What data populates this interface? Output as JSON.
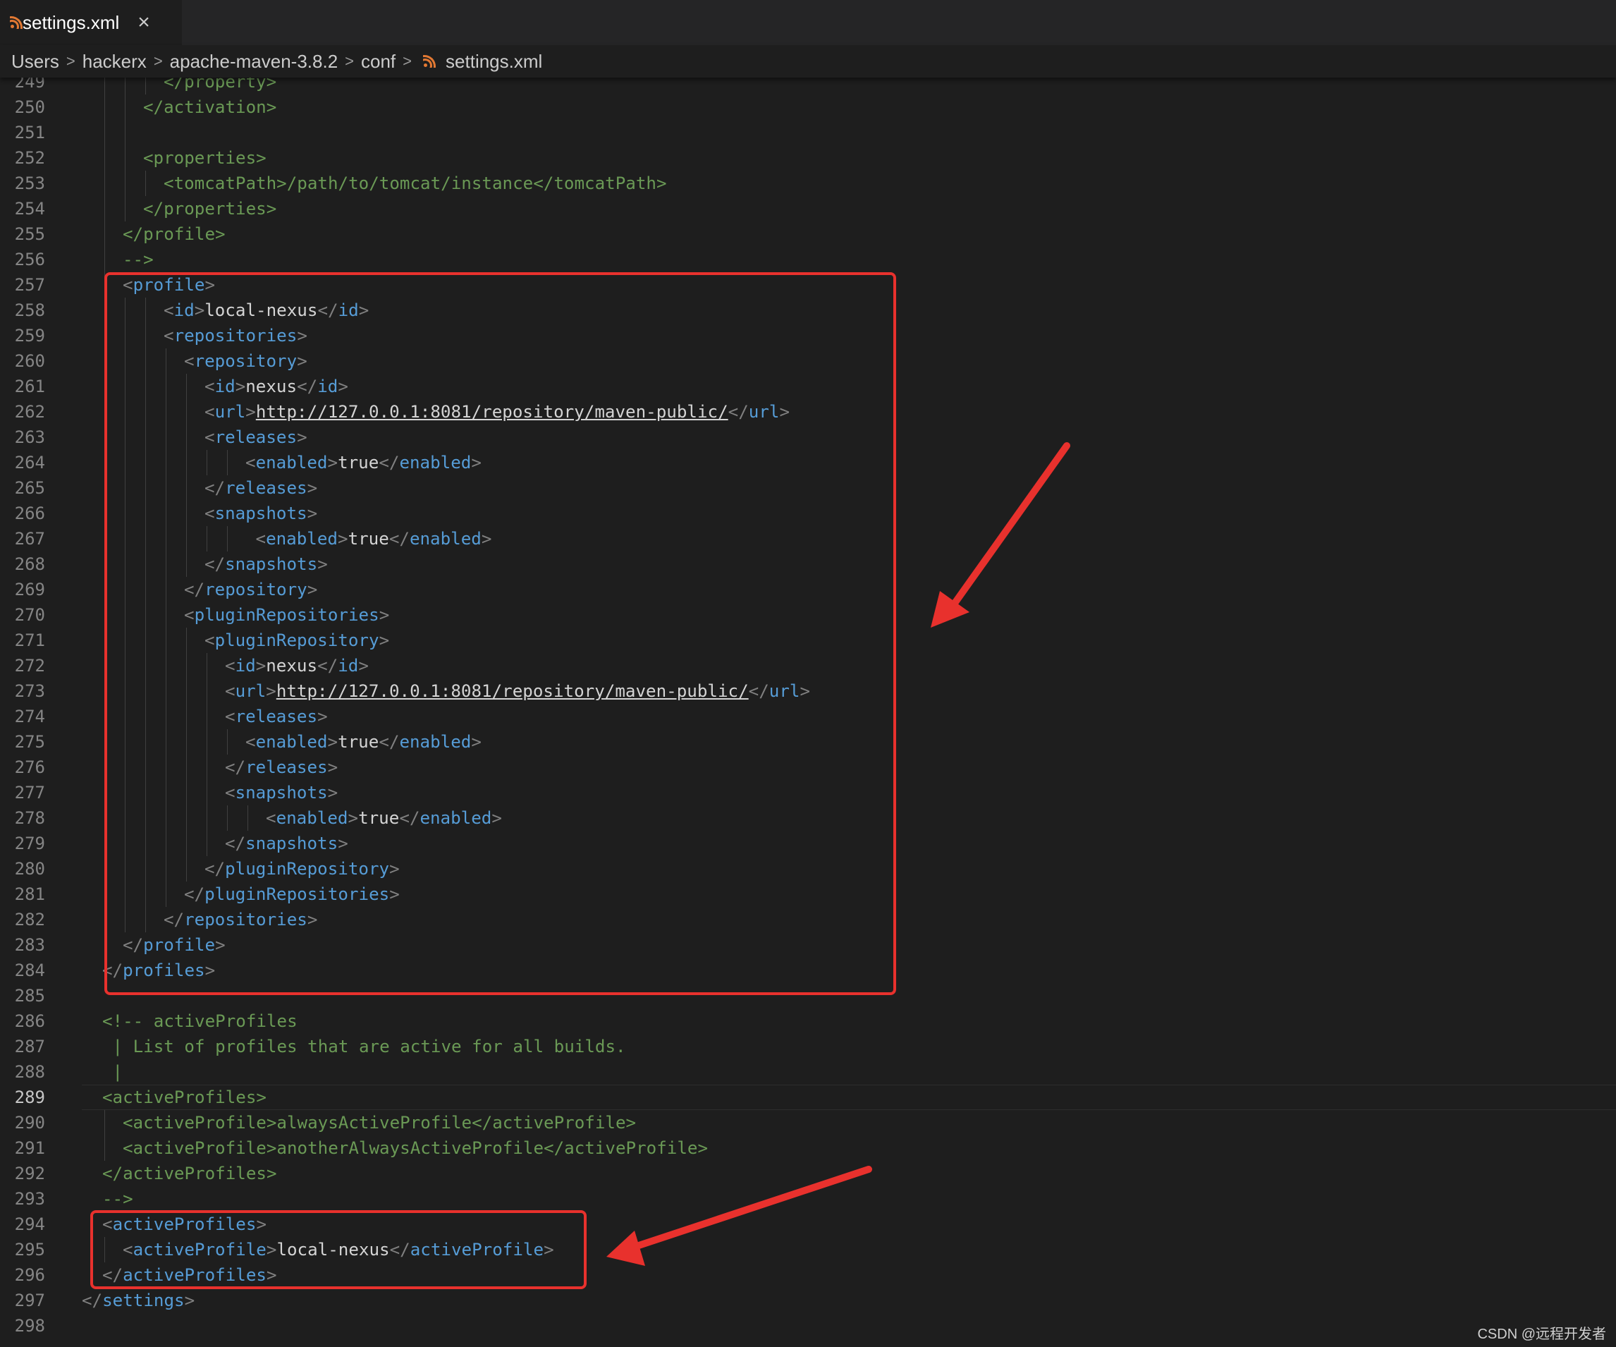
{
  "tab": {
    "filename": "settings.xml",
    "close_glyph": "×",
    "icon": "rss-icon"
  },
  "breadcrumb": {
    "segments": [
      "Users",
      "hackerx",
      "apache-maven-3.8.2",
      "conf"
    ],
    "file": "settings.xml",
    "separator": ">"
  },
  "editor": {
    "active_line": 289,
    "lines": [
      {
        "n": "249",
        "indent": 3,
        "tokens": [
          [
            "c",
            "</property>"
          ]
        ]
      },
      {
        "n": "250",
        "indent": 2,
        "tokens": [
          [
            "c",
            "</activation>"
          ]
        ]
      },
      {
        "n": "251",
        "indent": 2,
        "tokens": []
      },
      {
        "n": "252",
        "indent": 2,
        "tokens": [
          [
            "c",
            "<properties>"
          ]
        ]
      },
      {
        "n": "253",
        "indent": 3,
        "tokens": [
          [
            "c",
            "<tomcatPath>/path/to/tomcat/instance</tomcatPath>"
          ]
        ]
      },
      {
        "n": "254",
        "indent": 2,
        "tokens": [
          [
            "c",
            "</properties>"
          ]
        ]
      },
      {
        "n": "255",
        "indent": 1,
        "tokens": [
          [
            "c",
            "</profile>"
          ]
        ]
      },
      {
        "n": "256",
        "indent": 1,
        "tokens": [
          [
            "c",
            "-->"
          ]
        ]
      },
      {
        "n": "257",
        "indent": 1,
        "tokens": [
          [
            "g",
            "<"
          ],
          [
            "t",
            "profile"
          ],
          [
            "g",
            ">"
          ]
        ]
      },
      {
        "n": "258",
        "indent": 3,
        "tokens": [
          [
            "g",
            "<"
          ],
          [
            "t",
            "id"
          ],
          [
            "g",
            ">"
          ],
          [
            "x",
            "local-nexus"
          ],
          [
            "g",
            "</"
          ],
          [
            "t",
            "id"
          ],
          [
            "g",
            ">"
          ]
        ]
      },
      {
        "n": "259",
        "indent": 3,
        "tokens": [
          [
            "g",
            "<"
          ],
          [
            "t",
            "repositories"
          ],
          [
            "g",
            ">"
          ]
        ]
      },
      {
        "n": "260",
        "indent": 4,
        "tokens": [
          [
            "g",
            "<"
          ],
          [
            "t",
            "repository"
          ],
          [
            "g",
            ">"
          ]
        ]
      },
      {
        "n": "261",
        "indent": 5,
        "tokens": [
          [
            "g",
            "<"
          ],
          [
            "t",
            "id"
          ],
          [
            "g",
            ">"
          ],
          [
            "x",
            "nexus"
          ],
          [
            "g",
            "</"
          ],
          [
            "t",
            "id"
          ],
          [
            "g",
            ">"
          ]
        ]
      },
      {
        "n": "262",
        "indent": 5,
        "tokens": [
          [
            "g",
            "<"
          ],
          [
            "t",
            "url"
          ],
          [
            "g",
            ">"
          ],
          [
            "u",
            "http://127.0.0.1:8081/repository/maven-public/"
          ],
          [
            "g",
            "</"
          ],
          [
            "t",
            "url"
          ],
          [
            "g",
            ">"
          ]
        ]
      },
      {
        "n": "263",
        "indent": 5,
        "tokens": [
          [
            "g",
            "<"
          ],
          [
            "t",
            "releases"
          ],
          [
            "g",
            ">"
          ]
        ]
      },
      {
        "n": "264",
        "indent": 7,
        "tokens": [
          [
            "g",
            "<"
          ],
          [
            "t",
            "enabled"
          ],
          [
            "g",
            ">"
          ],
          [
            "x",
            "true"
          ],
          [
            "g",
            "</"
          ],
          [
            "t",
            "enabled"
          ],
          [
            "g",
            ">"
          ]
        ]
      },
      {
        "n": "265",
        "indent": 5,
        "tokens": [
          [
            "g",
            "</"
          ],
          [
            "t",
            "releases"
          ],
          [
            "g",
            ">"
          ]
        ]
      },
      {
        "n": "266",
        "indent": 5,
        "tokens": [
          [
            "g",
            "<"
          ],
          [
            "t",
            "snapshots"
          ],
          [
            "g",
            ">"
          ]
        ]
      },
      {
        "n": "267",
        "indent": 7.5,
        "tokens": [
          [
            "g",
            "<"
          ],
          [
            "t",
            "enabled"
          ],
          [
            "g",
            ">"
          ],
          [
            "x",
            "true"
          ],
          [
            "g",
            "</"
          ],
          [
            "t",
            "enabled"
          ],
          [
            "g",
            ">"
          ]
        ]
      },
      {
        "n": "268",
        "indent": 5,
        "tokens": [
          [
            "g",
            "</"
          ],
          [
            "t",
            "snapshots"
          ],
          [
            "g",
            ">"
          ]
        ]
      },
      {
        "n": "269",
        "indent": 4,
        "tokens": [
          [
            "g",
            "</"
          ],
          [
            "t",
            "repository"
          ],
          [
            "g",
            ">"
          ]
        ]
      },
      {
        "n": "270",
        "indent": 4,
        "tokens": [
          [
            "g",
            "<"
          ],
          [
            "t",
            "pluginRepositories"
          ],
          [
            "g",
            ">"
          ]
        ]
      },
      {
        "n": "271",
        "indent": 5,
        "tokens": [
          [
            "g",
            "<"
          ],
          [
            "t",
            "pluginRepository"
          ],
          [
            "g",
            ">"
          ]
        ]
      },
      {
        "n": "272",
        "indent": 6,
        "tokens": [
          [
            "g",
            "<"
          ],
          [
            "t",
            "id"
          ],
          [
            "g",
            ">"
          ],
          [
            "x",
            "nexus"
          ],
          [
            "g",
            "</"
          ],
          [
            "t",
            "id"
          ],
          [
            "g",
            ">"
          ]
        ]
      },
      {
        "n": "273",
        "indent": 6,
        "tokens": [
          [
            "g",
            "<"
          ],
          [
            "t",
            "url"
          ],
          [
            "g",
            ">"
          ],
          [
            "u",
            "http://127.0.0.1:8081/repository/maven-public/"
          ],
          [
            "g",
            "</"
          ],
          [
            "t",
            "url"
          ],
          [
            "g",
            ">"
          ]
        ]
      },
      {
        "n": "274",
        "indent": 6,
        "tokens": [
          [
            "g",
            "<"
          ],
          [
            "t",
            "releases"
          ],
          [
            "g",
            ">"
          ]
        ]
      },
      {
        "n": "275",
        "indent": 7,
        "tokens": [
          [
            "g",
            "<"
          ],
          [
            "t",
            "enabled"
          ],
          [
            "g",
            ">"
          ],
          [
            "x",
            "true"
          ],
          [
            "g",
            "</"
          ],
          [
            "t",
            "enabled"
          ],
          [
            "g",
            ">"
          ]
        ]
      },
      {
        "n": "276",
        "indent": 6,
        "tokens": [
          [
            "g",
            "</"
          ],
          [
            "t",
            "releases"
          ],
          [
            "g",
            ">"
          ]
        ]
      },
      {
        "n": "277",
        "indent": 6,
        "tokens": [
          [
            "g",
            "<"
          ],
          [
            "t",
            "snapshots"
          ],
          [
            "g",
            ">"
          ]
        ]
      },
      {
        "n": "278",
        "indent": 8,
        "tokens": [
          [
            "g",
            "<"
          ],
          [
            "t",
            "enabled"
          ],
          [
            "g",
            ">"
          ],
          [
            "x",
            "true"
          ],
          [
            "g",
            "</"
          ],
          [
            "t",
            "enabled"
          ],
          [
            "g",
            ">"
          ]
        ]
      },
      {
        "n": "279",
        "indent": 6,
        "tokens": [
          [
            "g",
            "</"
          ],
          [
            "t",
            "snapshots"
          ],
          [
            "g",
            ">"
          ]
        ]
      },
      {
        "n": "280",
        "indent": 5,
        "tokens": [
          [
            "g",
            "</"
          ],
          [
            "t",
            "pluginRepository"
          ],
          [
            "g",
            ">"
          ]
        ]
      },
      {
        "n": "281",
        "indent": 4,
        "tokens": [
          [
            "g",
            "</"
          ],
          [
            "t",
            "pluginRepositories"
          ],
          [
            "g",
            ">"
          ]
        ]
      },
      {
        "n": "282",
        "indent": 3,
        "tokens": [
          [
            "g",
            "</"
          ],
          [
            "t",
            "repositories"
          ],
          [
            "g",
            ">"
          ]
        ]
      },
      {
        "n": "283",
        "indent": 1,
        "tokens": [
          [
            "g",
            "</"
          ],
          [
            "t",
            "profile"
          ],
          [
            "g",
            ">"
          ]
        ]
      },
      {
        "n": "284",
        "indent": 0,
        "tokens": [
          [
            "g",
            "</"
          ],
          [
            "t",
            "profiles"
          ],
          [
            "g",
            ">"
          ]
        ]
      },
      {
        "n": "285",
        "indent": 0,
        "tokens": []
      },
      {
        "n": "286",
        "indent": 0,
        "tokens": [
          [
            "c",
            "<!-- activeProfiles"
          ]
        ]
      },
      {
        "n": "287",
        "indent": 0.5,
        "tokens": [
          [
            "c",
            "| List of profiles that are active for all builds."
          ]
        ]
      },
      {
        "n": "288",
        "indent": 0.5,
        "tokens": [
          [
            "c",
            "|"
          ]
        ]
      },
      {
        "n": "289",
        "indent": 0,
        "tokens": [
          [
            "c",
            "<activeProfiles>"
          ]
        ]
      },
      {
        "n": "290",
        "indent": 1,
        "tokens": [
          [
            "c",
            "<activeProfile>alwaysActiveProfile</activeProfile>"
          ]
        ]
      },
      {
        "n": "291",
        "indent": 1,
        "tokens": [
          [
            "c",
            "<activeProfile>anotherAlwaysActiveProfile</activeProfile>"
          ]
        ]
      },
      {
        "n": "292",
        "indent": 0,
        "tokens": [
          [
            "c",
            "</activeProfiles>"
          ]
        ]
      },
      {
        "n": "293",
        "indent": 0,
        "tokens": [
          [
            "c",
            "-->"
          ]
        ]
      },
      {
        "n": "294",
        "indent": 0,
        "tokens": [
          [
            "g",
            "<"
          ],
          [
            "t",
            "activeProfiles"
          ],
          [
            "g",
            ">"
          ]
        ]
      },
      {
        "n": "295",
        "indent": 1,
        "tokens": [
          [
            "g",
            "<"
          ],
          [
            "t",
            "activeProfile"
          ],
          [
            "g",
            ">"
          ],
          [
            "x",
            "local-nexus"
          ],
          [
            "g",
            "</"
          ],
          [
            "t",
            "activeProfile"
          ],
          [
            "g",
            ">"
          ]
        ]
      },
      {
        "n": "296",
        "indent": 0,
        "tokens": [
          [
            "g",
            "</"
          ],
          [
            "t",
            "activeProfiles"
          ],
          [
            "g",
            ">"
          ]
        ]
      },
      {
        "n": "297",
        "indent": -1,
        "tokens": [
          [
            "g",
            "</"
          ],
          [
            "t",
            "settings"
          ],
          [
            "g",
            ">"
          ]
        ]
      },
      {
        "n": "298",
        "indent": -1,
        "tokens": []
      }
    ]
  },
  "annotations": {
    "box_color": "#e8312d"
  },
  "colors": {
    "tag": "#569cd6",
    "bracket": "#808080",
    "text": "#d4d4d4",
    "comment": "#6a9955",
    "background": "#1e1e1e"
  },
  "watermark": "CSDN @远程开发者"
}
